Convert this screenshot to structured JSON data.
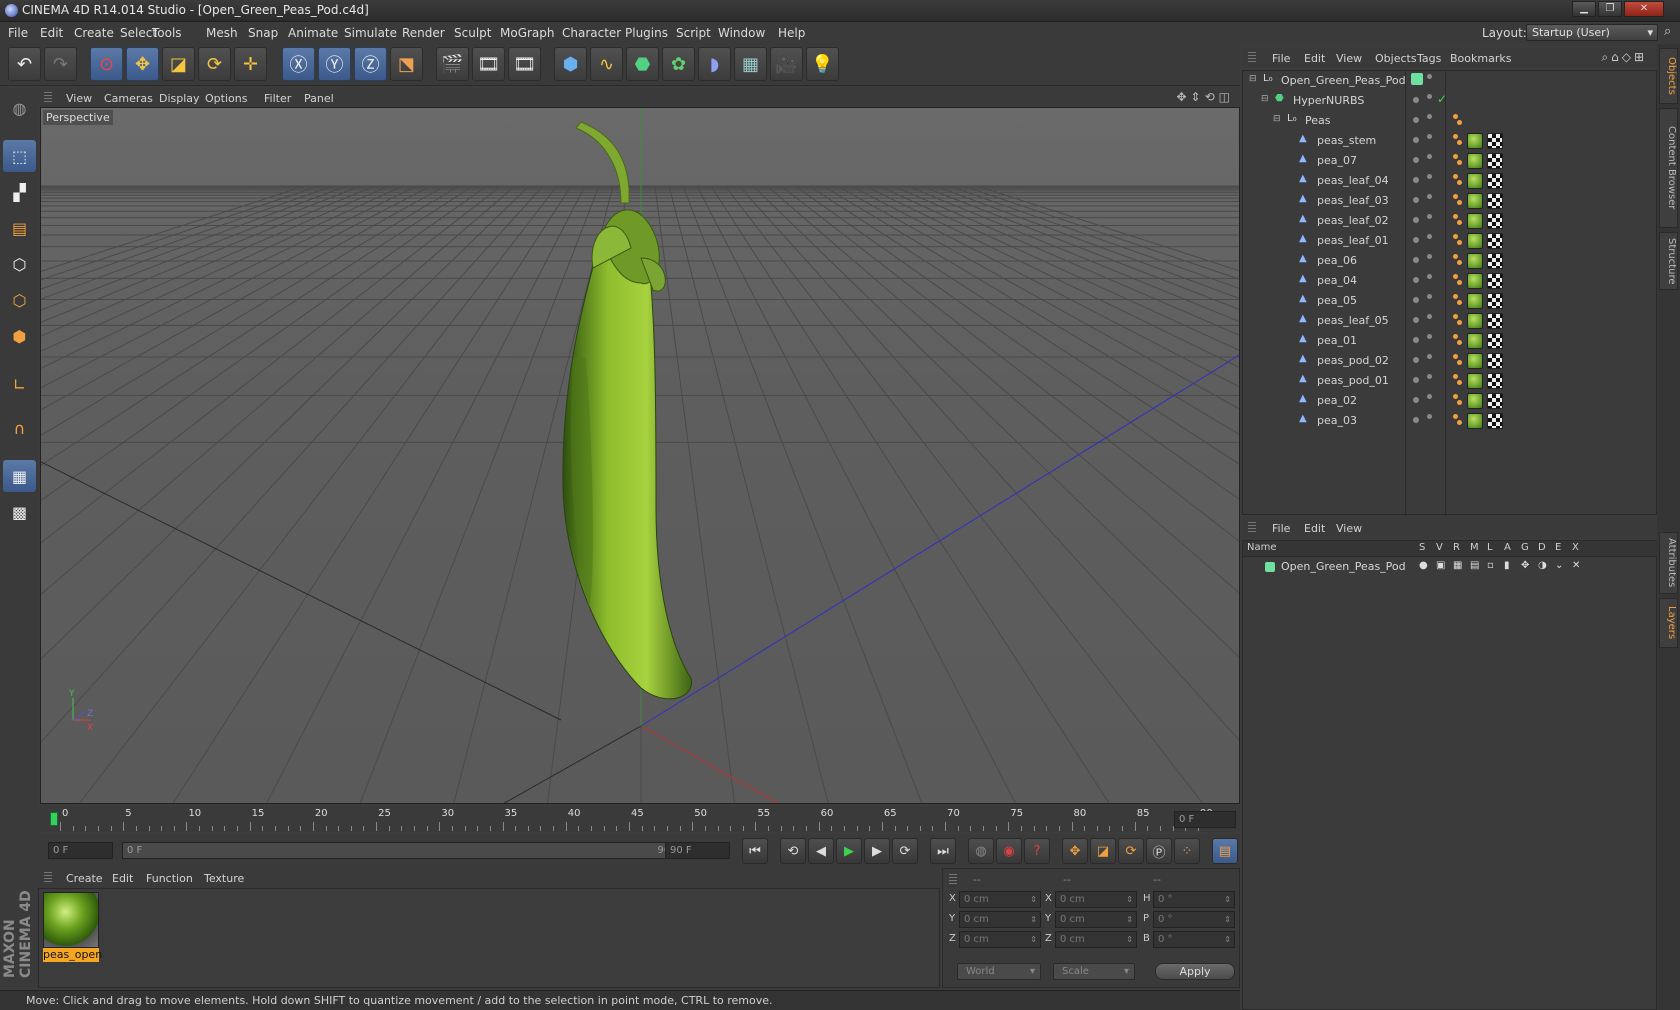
{
  "window": {
    "title": "CINEMA 4D R14.014 Studio - [Open_Green_Peas_Pod.c4d]"
  },
  "menubar": [
    "File",
    "Edit",
    "Create",
    "Select",
    "Tools",
    "Mesh",
    "Snap",
    "Animate",
    "Simulate",
    "Render",
    "Sculpt",
    "MoGraph",
    "Character",
    "Plugins",
    "Script",
    "Window",
    "Help"
  ],
  "layout": {
    "label": "Layout:",
    "value": "Startup (User)"
  },
  "viewport": {
    "menu": [
      "View",
      "Cameras",
      "Display",
      "Options",
      "Filter",
      "Panel"
    ],
    "label": "Perspective"
  },
  "timeline": {
    "ticks": [
      "0",
      "5",
      "10",
      "15",
      "20",
      "25",
      "30",
      "35",
      "40",
      "45",
      "50",
      "55",
      "60",
      "65",
      "70",
      "75",
      "80",
      "85",
      "90"
    ],
    "current_frame": "0 F",
    "start_field": "0 F",
    "range_start": "0 F",
    "range_end": "90 F",
    "end_field": "90 F"
  },
  "materials": {
    "menu": [
      "Create",
      "Edit",
      "Function",
      "Texture"
    ],
    "items": [
      {
        "label": "peas_open"
      }
    ]
  },
  "coordinates": {
    "header": [
      "--",
      "--",
      "--"
    ],
    "rows": [
      {
        "a": "X",
        "av": "0 cm",
        "b": "X",
        "bv": "0 cm",
        "c": "H",
        "cv": "0 °"
      },
      {
        "a": "Y",
        "av": "0 cm",
        "b": "Y",
        "bv": "0 cm",
        "c": "P",
        "cv": "0 °"
      },
      {
        "a": "Z",
        "av": "0 cm",
        "b": "Z",
        "bv": "0 cm",
        "c": "B",
        "cv": "0 °"
      }
    ],
    "mode": "World",
    "type": "Scale",
    "apply": "Apply"
  },
  "object_manager": {
    "menu": [
      "File",
      "Edit",
      "View",
      "Objects",
      "Tags",
      "Bookmarks"
    ],
    "objects": [
      {
        "name": "Open_Green_Peas_Pod",
        "level": 0,
        "kind": "null"
      },
      {
        "name": "HyperNURBS",
        "level": 1,
        "kind": "nurbs"
      },
      {
        "name": "Peas",
        "level": 2,
        "kind": "null"
      },
      {
        "name": "peas_stem",
        "level": 3,
        "kind": "poly"
      },
      {
        "name": "pea_07",
        "level": 3,
        "kind": "poly"
      },
      {
        "name": "peas_leaf_04",
        "level": 3,
        "kind": "poly"
      },
      {
        "name": "peas_leaf_03",
        "level": 3,
        "kind": "poly"
      },
      {
        "name": "peas_leaf_02",
        "level": 3,
        "kind": "poly"
      },
      {
        "name": "peas_leaf_01",
        "level": 3,
        "kind": "poly"
      },
      {
        "name": "pea_06",
        "level": 3,
        "kind": "poly"
      },
      {
        "name": "pea_04",
        "level": 3,
        "kind": "poly"
      },
      {
        "name": "pea_05",
        "level": 3,
        "kind": "poly"
      },
      {
        "name": "peas_leaf_05",
        "level": 3,
        "kind": "poly"
      },
      {
        "name": "pea_01",
        "level": 3,
        "kind": "poly"
      },
      {
        "name": "peas_pod_02",
        "level": 3,
        "kind": "poly"
      },
      {
        "name": "peas_pod_01",
        "level": 3,
        "kind": "poly"
      },
      {
        "name": "pea_02",
        "level": 3,
        "kind": "poly"
      },
      {
        "name": "pea_03",
        "level": 3,
        "kind": "poly"
      }
    ]
  },
  "layer_manager": {
    "menu": [
      "File",
      "Edit",
      "View"
    ],
    "columns": [
      "Name",
      "S",
      "V",
      "R",
      "M",
      "L",
      "A",
      "G",
      "D",
      "E",
      "X"
    ],
    "layers": [
      {
        "name": "Open_Green_Peas_Pod",
        "color": "#6fe0a0"
      }
    ]
  },
  "right_tabs": [
    "Objects",
    "Content Browser",
    "Structure",
    "Attributes",
    "Layers"
  ],
  "brand": "MAXON CINEMA 4D",
  "status": "Move: Click and drag to move elements. Hold down SHIFT to quantize movement / add to the selection in point mode, CTRL to remove."
}
